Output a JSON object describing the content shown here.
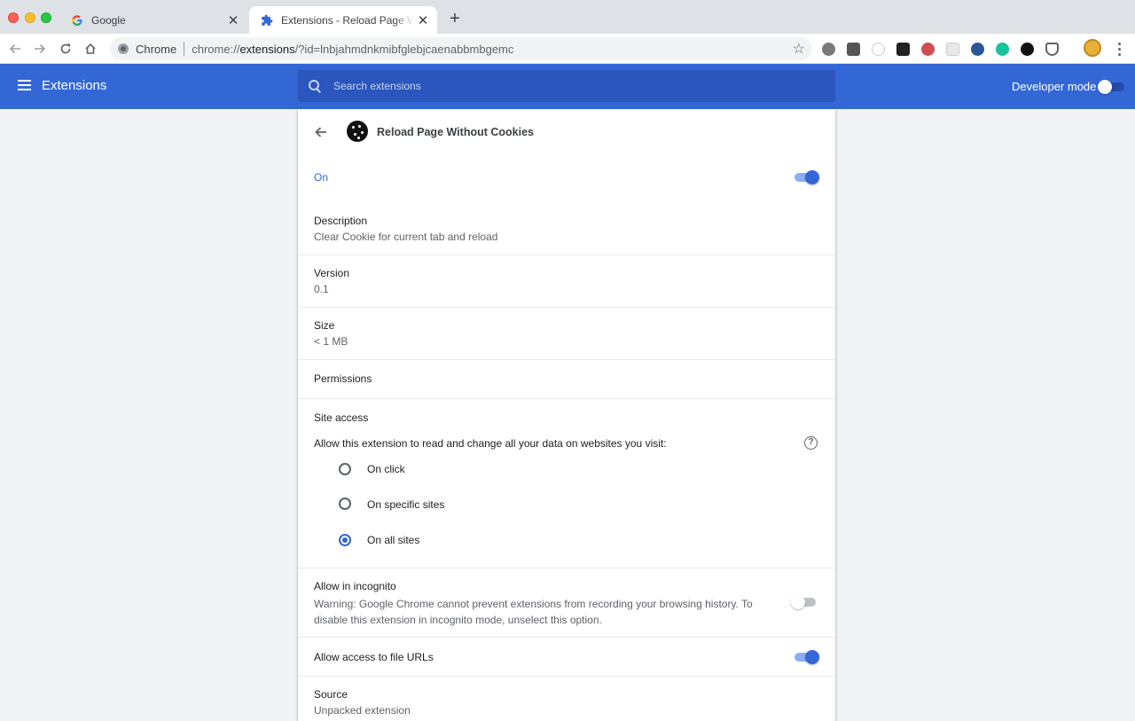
{
  "window": {
    "tabs": [
      {
        "title": "Google",
        "favicon": "google-g-icon"
      },
      {
        "title": "Extensions - Reload Page Without Cookies",
        "favicon": "puzzle-piece-icon",
        "active": true
      }
    ],
    "new_tab_symbol": "+"
  },
  "toolbar": {
    "scheme_label": "Chrome",
    "url_prefix": "chrome://",
    "url_host": "extensions",
    "url_path": "/?id=lnbjahmdnkmibfglebjcaenabbmbgemc"
  },
  "header": {
    "title": "Extensions",
    "search_placeholder": "Search extensions",
    "developer_mode_label": "Developer mode",
    "developer_mode_on": false
  },
  "detail": {
    "name": "Reload Page Without Cookies",
    "enabled_label": "On",
    "enabled": true,
    "description_label": "Description",
    "description": "Clear Cookie for current tab and reload",
    "version_label": "Version",
    "version": "0.1",
    "size_label": "Size",
    "size": "< 1 MB",
    "permissions_label": "Permissions",
    "site_access_label": "Site access",
    "site_access_prompt": "Allow this extension to read and change all your data on websites you visit:",
    "site_access_options": [
      {
        "label": "On click",
        "selected": false
      },
      {
        "label": "On specific sites",
        "selected": false
      },
      {
        "label": "On all sites",
        "selected": true
      }
    ],
    "incognito_label": "Allow in incognito",
    "incognito_warning": "Warning: Google Chrome cannot prevent extensions from recording your browsing history. To disable this extension in incognito mode, unselect this option.",
    "incognito_enabled": false,
    "file_urls_label": "Allow access to file URLs",
    "file_urls_enabled": true,
    "source_label": "Source",
    "source_value": "Unpacked extension"
  },
  "colors": {
    "accent": "#3367d6",
    "header_bg": "#3367d6",
    "page_bg": "#f1f3f4"
  }
}
